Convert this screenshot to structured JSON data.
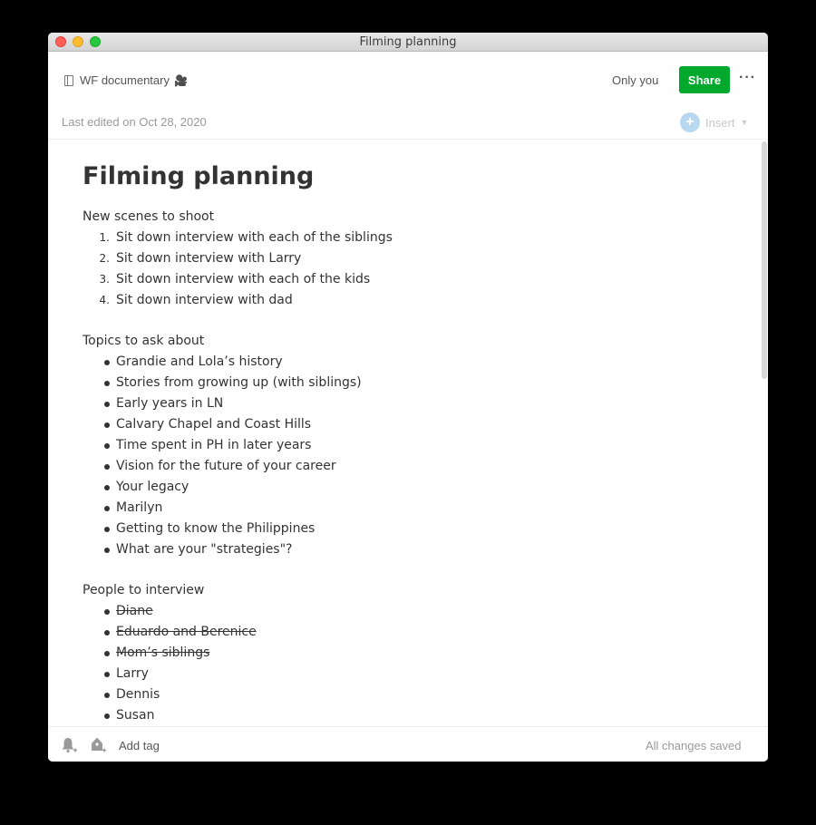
{
  "window": {
    "title": "Filming planning"
  },
  "header": {
    "notebook": "WF documentary",
    "notebook_emoji": "🎥",
    "sharing": "Only you",
    "share_label": "Share",
    "more_label": "···"
  },
  "meta": {
    "last_edited": "Last edited on Oct 28, 2020",
    "insert_label": "Insert"
  },
  "note": {
    "title": "Filming planning",
    "section1": {
      "heading": "New scenes to shoot",
      "items": [
        {
          "num": "1.",
          "text": "Sit down interview with each of the siblings"
        },
        {
          "num": "2.",
          "text": "Sit down interview with Larry"
        },
        {
          "num": "3.",
          "text": "Sit down interview with each of the kids"
        },
        {
          "num": "4.",
          "text": "Sit down interview with dad"
        }
      ]
    },
    "section2": {
      "heading": "Topics to ask about",
      "items": [
        "Grandie and Lola’s history",
        "Stories from growing up (with siblings)",
        "Early years in LN",
        "Calvary Chapel and Coast Hills",
        "Time spent in PH in later years",
        "Vision for the future of your career",
        "Your legacy",
        "Marilyn",
        "Getting to know the Philippines",
        "What are your \"strategies\"?"
      ]
    },
    "section3": {
      "heading": "People to interview",
      "items": [
        {
          "text": "Diane",
          "done": true
        },
        {
          "text": "Eduardo and Berenice",
          "done": true
        },
        {
          "text": "Mom’s siblings",
          "done": true
        },
        {
          "text": "Larry",
          "done": false
        },
        {
          "text": "Dennis",
          "done": false
        },
        {
          "text": "Susan",
          "done": false
        }
      ]
    }
  },
  "footer": {
    "add_tag": "Add tag",
    "status": "All changes saved"
  },
  "colors": {
    "share_button": "#00a82d",
    "insert_accent": "#b8d8ef"
  }
}
